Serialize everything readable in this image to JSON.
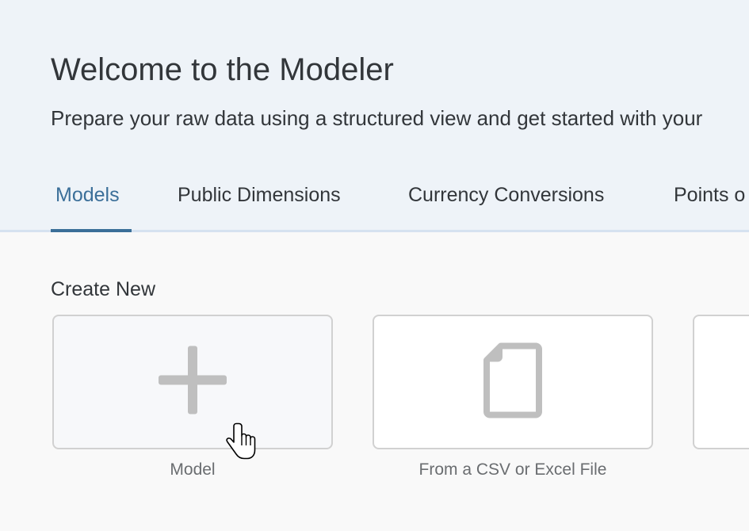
{
  "header": {
    "title": "Welcome to the Modeler",
    "subtitle": "Prepare your raw data using a structured view and get started with your"
  },
  "tabs": [
    {
      "label": "Models",
      "active": true
    },
    {
      "label": "Public Dimensions",
      "active": false
    },
    {
      "label": "Currency Conversions",
      "active": false
    },
    {
      "label": "Points o",
      "active": false
    }
  ],
  "create_new": {
    "title": "Create New",
    "tiles": [
      {
        "label": "Model",
        "icon": "plus-icon"
      },
      {
        "label": "From a CSV or Excel File",
        "icon": "document-icon"
      },
      {
        "label": "",
        "icon": ""
      }
    ]
  },
  "colors": {
    "accent": "#3b6f99",
    "header_bg": "#eef3f8",
    "icon_gray": "#bfbfbf"
  }
}
